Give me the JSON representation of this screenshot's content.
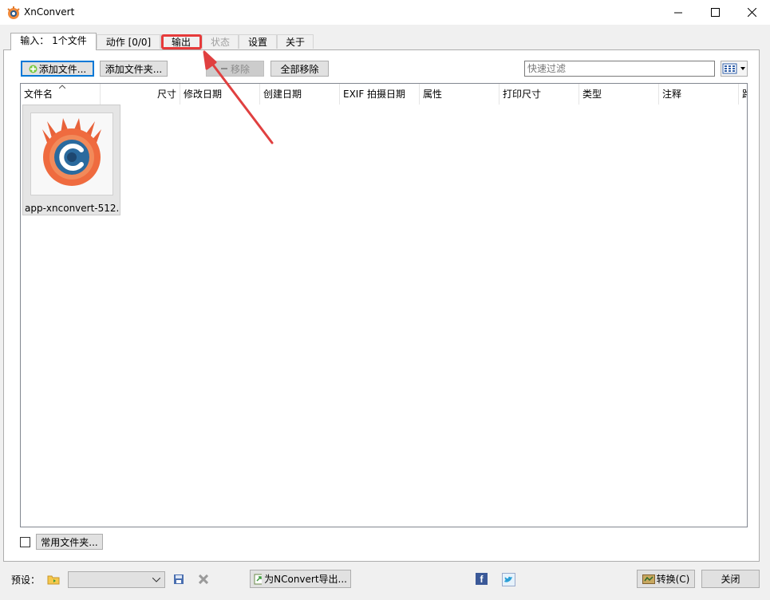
{
  "window": {
    "title": "XnConvert",
    "minimize_icon": "minimize-icon",
    "maximize_icon": "maximize-icon",
    "close_icon": "close-icon"
  },
  "tabs": [
    {
      "label": "输入： 1个文件",
      "state": "active"
    },
    {
      "label": "动作 [0/0]",
      "state": "normal"
    },
    {
      "label": "输出",
      "state": "normal"
    },
    {
      "label": "状态",
      "state": "disabled"
    },
    {
      "label": "设置",
      "state": "normal"
    },
    {
      "label": "关于",
      "state": "normal"
    }
  ],
  "toolbar": {
    "add_files": "添加文件...",
    "add_folder": "添加文件夹...",
    "remove": "移除",
    "remove_all": "全部移除",
    "filter_placeholder": "快速过滤"
  },
  "columns": [
    "文件名",
    "尺寸",
    "修改日期",
    "创建日期",
    "EXIF 拍摄日期",
    "属性",
    "打印尺寸",
    "类型",
    "注释",
    "路"
  ],
  "files": [
    {
      "name": "app-xnconvert-512..."
    }
  ],
  "bottom": {
    "favorites_button": "常用文件夹...",
    "preset_label": "预设：",
    "export_button": "为NConvert导出...",
    "convert_button": "转换(C)",
    "close_button": "关闭"
  },
  "colors": {
    "highlight": "#e63a3a",
    "accent": "#0078d7"
  }
}
